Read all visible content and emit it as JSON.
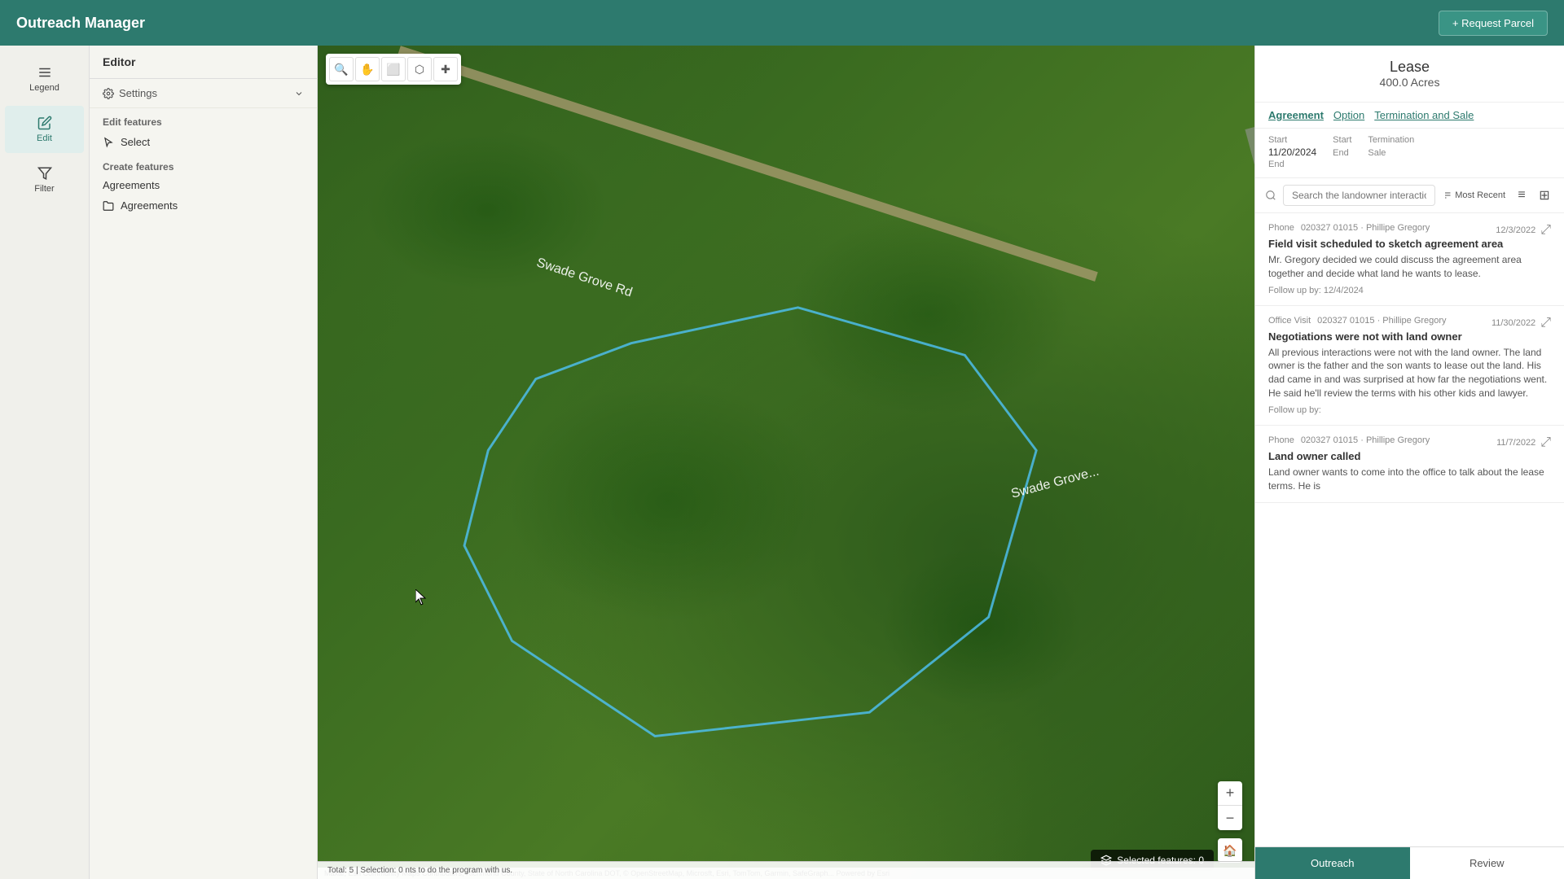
{
  "app": {
    "title": "Outreach Manager",
    "request_parcel_label": "+ Request Parcel"
  },
  "leftnav": {
    "items": [
      {
        "id": "legend",
        "label": "Legend",
        "icon": "list"
      },
      {
        "id": "edit",
        "label": "Edit",
        "icon": "pencil",
        "active": true
      },
      {
        "id": "filter",
        "label": "Filter",
        "icon": "filter"
      }
    ]
  },
  "editor": {
    "title": "Editor",
    "settings_label": "Settings",
    "edit_features_label": "Edit features",
    "select_label": "Select",
    "create_features_label": "Create features",
    "agreements_group_label": "Agreements",
    "agreements_item_label": "Agreements"
  },
  "map": {
    "selected_features": "Selected features: 0",
    "attribution": "Maxar, Esri Community Maps Contributors, Richmond County, State of North Carolina DOT, © OpenStreetMap, Microsft, Esri, TomTom, Garmin, SafeGraph... Powered by Esri"
  },
  "right_panel": {
    "lease_title": "Lease",
    "lease_acres": "400.0 Acres",
    "tabs": [
      {
        "label": "Agreement",
        "active": true
      },
      {
        "label": "Option"
      },
      {
        "label": "Termination and Sale"
      }
    ],
    "lease_info": [
      {
        "label": "Start",
        "value": "11/20/2024"
      },
      {
        "label": "End",
        "value": ""
      },
      {
        "label": "Start",
        "value": ""
      },
      {
        "label": "End",
        "value": ""
      },
      {
        "label": "Termination",
        "value": ""
      },
      {
        "label": "Sale",
        "value": ""
      }
    ],
    "search_placeholder": "Search the landowner interactions",
    "sort_label": "Most Recent",
    "interactions": [
      {
        "type": "Phone",
        "meta": "020327 01015 · Phillipe Gregory",
        "date": "12/3/2022",
        "title": "Field visit scheduled to sketch agreement area",
        "body": "Mr. Gregory decided we could discuss the agreement area together and decide what land he wants to lease.",
        "followup": "Follow up by: 12/4/2024"
      },
      {
        "type": "Office Visit",
        "meta": "020327 01015 · Phillipe Gregory",
        "date": "11/30/2022",
        "title": "Negotiations were not with land owner",
        "body": "All previous interactions were not with the land owner. The land owner is the father and the son wants to lease out the land. His dad came in and was surprised at how far the negotiations went. He said he'll review the terms with his other kids and lawyer.",
        "followup": "Follow up by:"
      },
      {
        "type": "Phone",
        "meta": "020327 01015 · Phillipe Gregory",
        "date": "11/7/2022",
        "title": "Land owner called",
        "body": "Land owner wants to come into the office to talk about the lease terms. He is",
        "followup": ""
      }
    ],
    "status_bar": "Total: 5 | Selection: 0 nts to do the program with us.",
    "bottom_tabs": [
      {
        "label": "Outreach",
        "active": true
      },
      {
        "label": "Review"
      }
    ]
  }
}
